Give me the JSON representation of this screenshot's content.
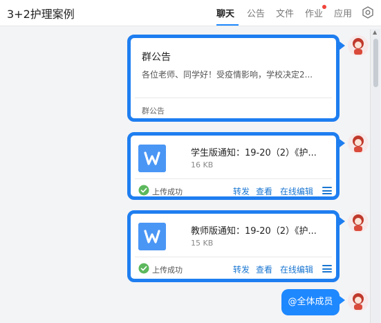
{
  "header": {
    "title": "3+2护理案例",
    "tabs": [
      {
        "label": "聊天",
        "active": true
      },
      {
        "label": "公告",
        "active": false
      },
      {
        "label": "文件",
        "active": false
      },
      {
        "label": "作业",
        "active": false,
        "badge": true
      },
      {
        "label": "应用",
        "active": false
      }
    ],
    "settings_icon": "hexagon-gear-icon"
  },
  "messages": {
    "announcement": {
      "title": "群公告",
      "body": "各位老师、同学好！受疫情影响，学校决定2...",
      "footer": "群公告"
    },
    "files": [
      {
        "name": "学生版通知：19-20（2）《护...",
        "size": "16 KB",
        "status": "上传成功",
        "actions": {
          "forward": "转发",
          "view": "查看",
          "edit_online": "在线编辑"
        }
      },
      {
        "name": "教师版通知：19-20（2）《护...",
        "size": "15 KB",
        "status": "上传成功",
        "actions": {
          "forward": "转发",
          "view": "查看",
          "edit_online": "在线编辑"
        }
      }
    ],
    "mention": "@全体成员"
  },
  "colors": {
    "accent": "#1e88ff",
    "card_border": "#1e7ef0",
    "success": "#5cb85c",
    "badge": "#f0443b",
    "doc_icon": "#4a96f5"
  }
}
